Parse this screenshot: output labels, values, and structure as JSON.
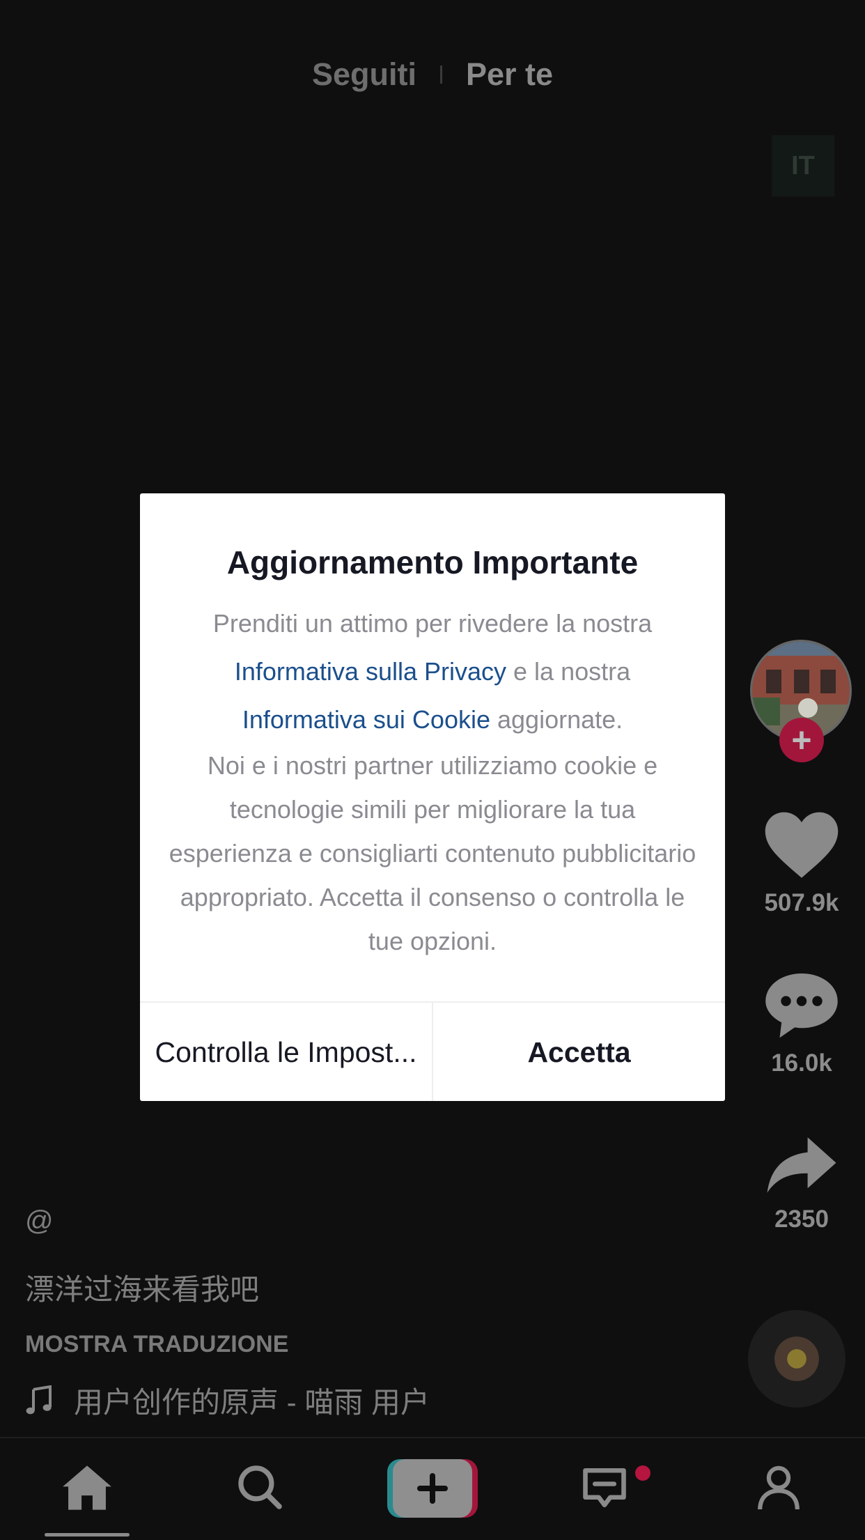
{
  "top_tabs": {
    "following": "Seguiti",
    "for_you": "Per te"
  },
  "language_badge": "IT",
  "actions": {
    "likes": "507.9k",
    "comments": "16.0k",
    "shares": "2350",
    "follow_plus": "+"
  },
  "caption": {
    "username": "@",
    "text": "漂洋过海来看我吧",
    "translate": "MOSTRA TRADUZIONE",
    "music": "用户创作的原声 - 喵雨    用户"
  },
  "dialog": {
    "title": "Aggiornamento Importante",
    "intro": "Prenditi un attimo per rivedere la nostra",
    "privacy_link": "Informativa sulla Privacy",
    "mid": " e la nostra",
    "cookie_link": "Informativa sui Cookie",
    "end": " aggiornate.",
    "body": "Noi e i nostri partner utilizziamo cookie e tecnologie simili per migliorare la tua esperienza e consigliarti contenuto pubblicitario appropriato. Accetta il consenso o controlla le tue opzioni.",
    "manage_label": "Controlla le Impost...",
    "accept_label": "Accetta"
  },
  "colors": {
    "link": "#1b4f8c",
    "accent_red": "#a3163b"
  },
  "nav": {
    "items": [
      "home-icon",
      "search-icon",
      "create-icon",
      "inbox-icon",
      "profile-icon"
    ]
  }
}
